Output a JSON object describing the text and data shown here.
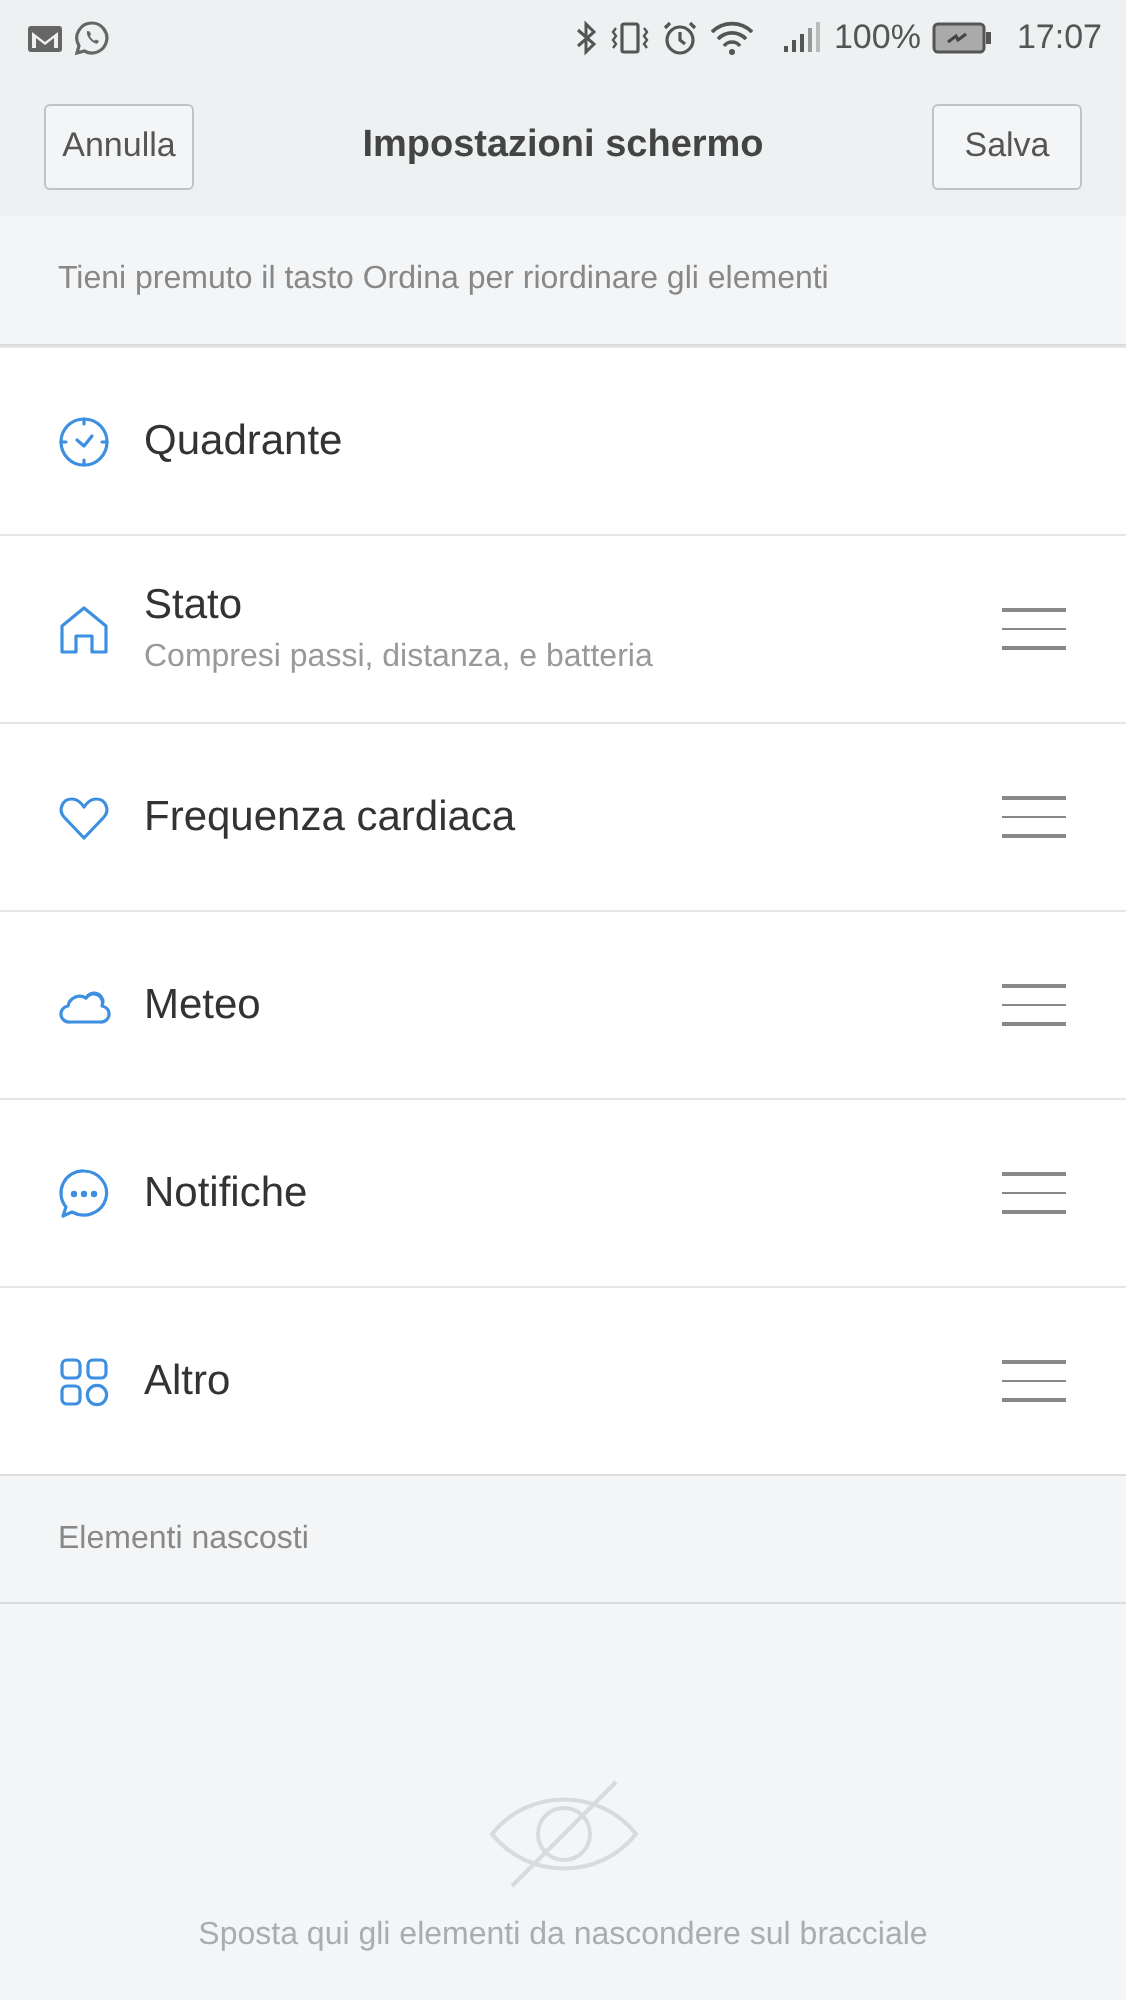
{
  "status_bar": {
    "battery_text": "100%",
    "time": "17:07"
  },
  "header": {
    "cancel": "Annulla",
    "title": "Impostazioni schermo",
    "save": "Salva"
  },
  "hint": "Tieni premuto il tasto Ordina per riordinare gli elementi",
  "items": [
    {
      "kind": "clock",
      "label": "Quadrante",
      "draggable": false
    },
    {
      "kind": "home",
      "label": "Stato",
      "subtitle": "Compresi passi, distanza, e batteria",
      "draggable": true
    },
    {
      "kind": "heart",
      "label": "Frequenza cardiaca",
      "draggable": true
    },
    {
      "kind": "cloud",
      "label": "Meteo",
      "draggable": true
    },
    {
      "kind": "chat",
      "label": "Notifiche",
      "draggable": true
    },
    {
      "kind": "grid",
      "label": "Altro",
      "draggable": true
    }
  ],
  "hidden": {
    "title": "Elementi nascosti",
    "empty_text": "Sposta qui gli elementi da nascondere sul bracciale"
  }
}
